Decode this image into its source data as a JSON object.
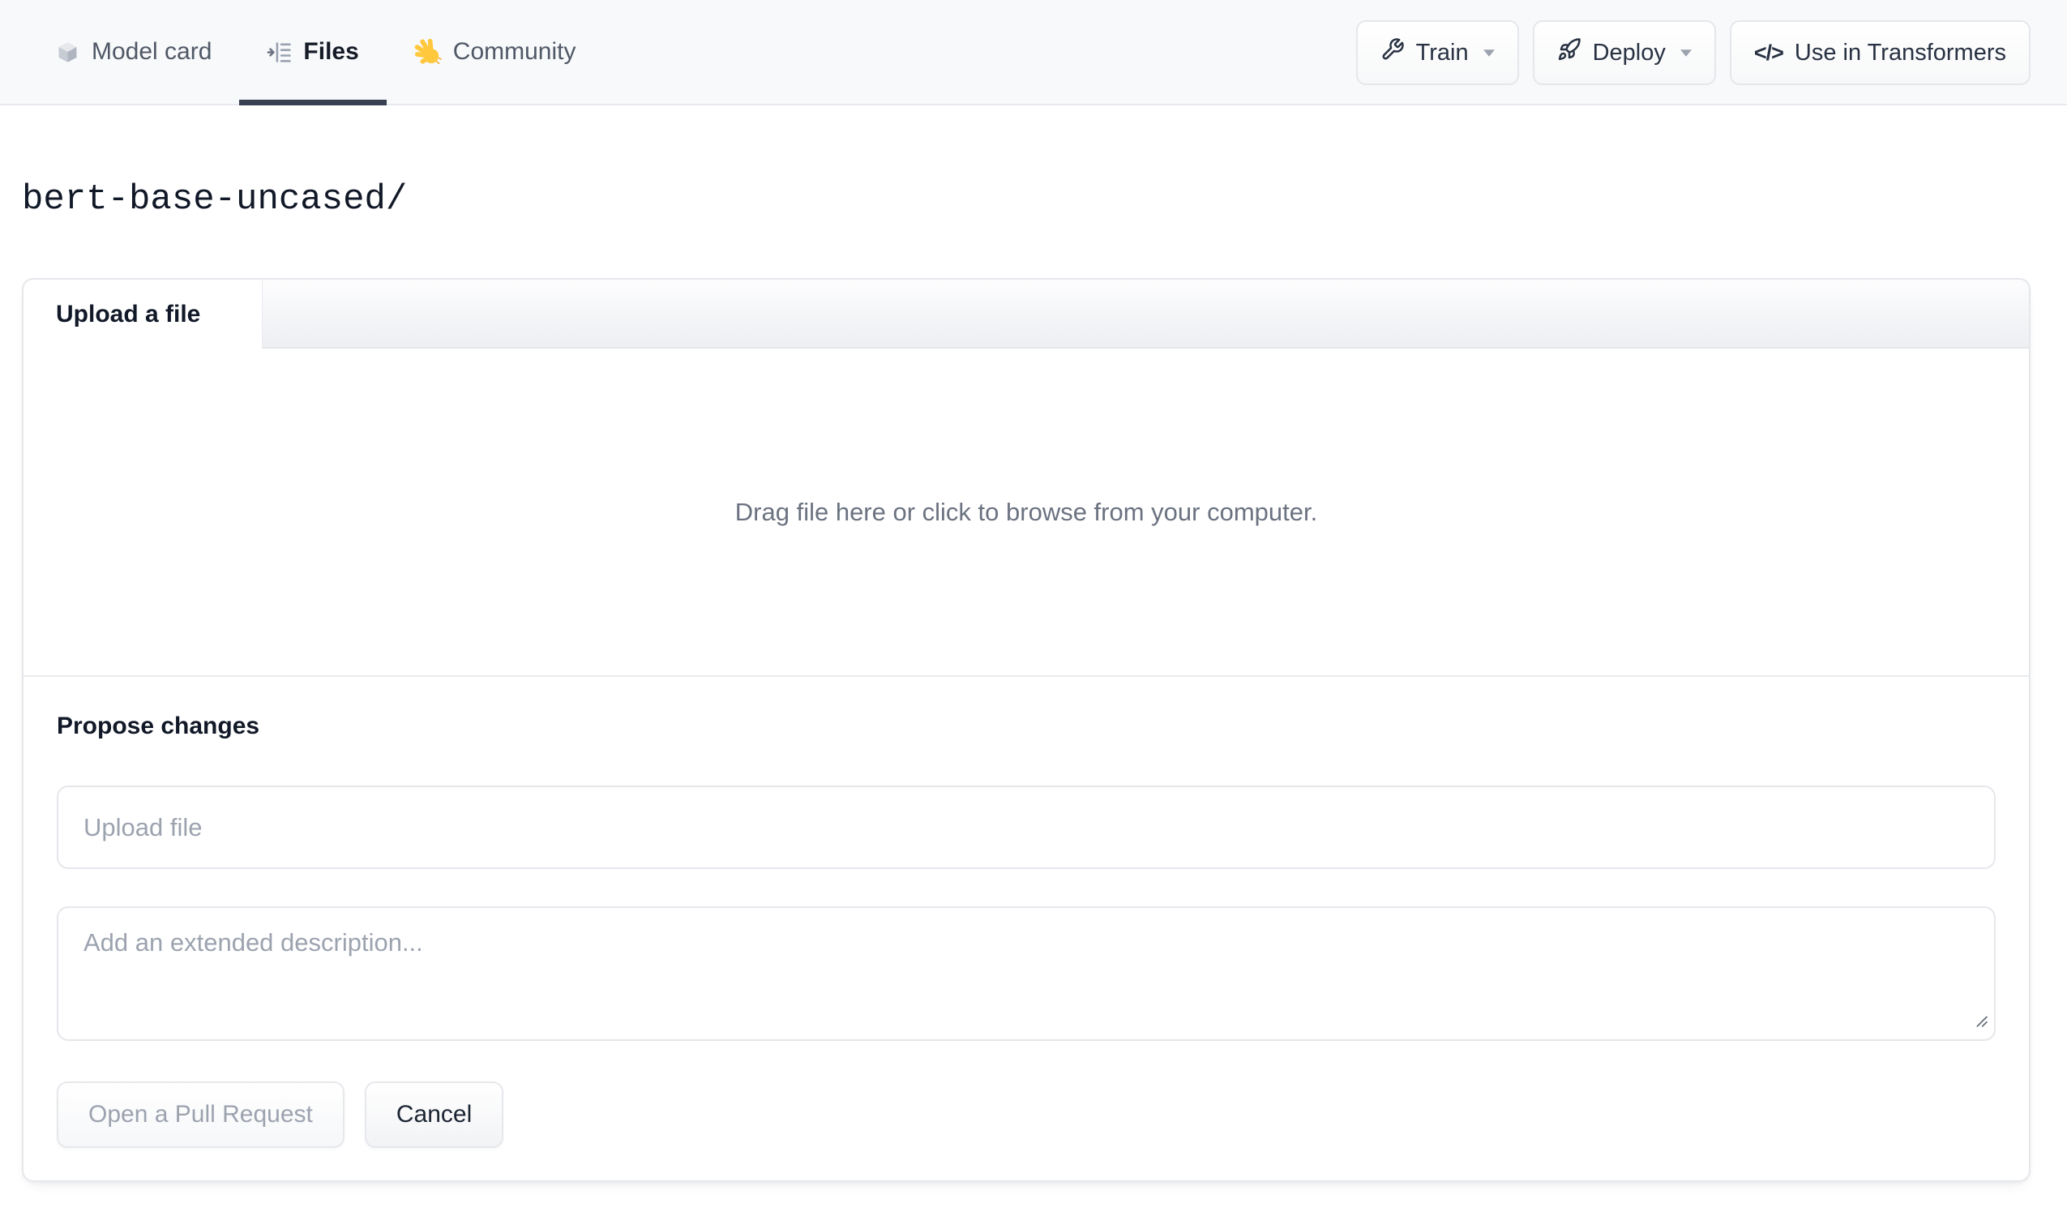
{
  "header": {
    "tabs": [
      {
        "label": "Model card",
        "icon": "cube"
      },
      {
        "label": "Files",
        "icon": "file-tree",
        "active": true
      },
      {
        "label": "Community",
        "icon": "waving-hand"
      }
    ],
    "actions": {
      "train": {
        "label": "Train",
        "icon": "wrench",
        "has_dropdown": true
      },
      "deploy": {
        "label": "Deploy",
        "icon": "rocket",
        "has_dropdown": true
      },
      "use_in_transformers": {
        "label": "Use in Transformers",
        "icon": "code",
        "code_glyph": "</>"
      }
    }
  },
  "path": {
    "repo": "bert-base-uncased/"
  },
  "upload_panel": {
    "tab_label": "Upload a file",
    "dropzone_text": "Drag file here or click to browse from your computer.",
    "propose": {
      "heading": "Propose changes",
      "filename_placeholder": "Upload file",
      "description_placeholder": "Add an extended description...",
      "open_pr_label": "Open a Pull Request",
      "cancel_label": "Cancel"
    }
  },
  "colors": {
    "header_bg": "#f8f9fb",
    "active_tab_underline": "#374151",
    "panel_border": "#e5e7eb",
    "muted_text": "#6b7280",
    "placeholder_text": "#9ca3af",
    "hand_emoji_yellow": "#FFC83D",
    "dark_text": "#111827"
  }
}
